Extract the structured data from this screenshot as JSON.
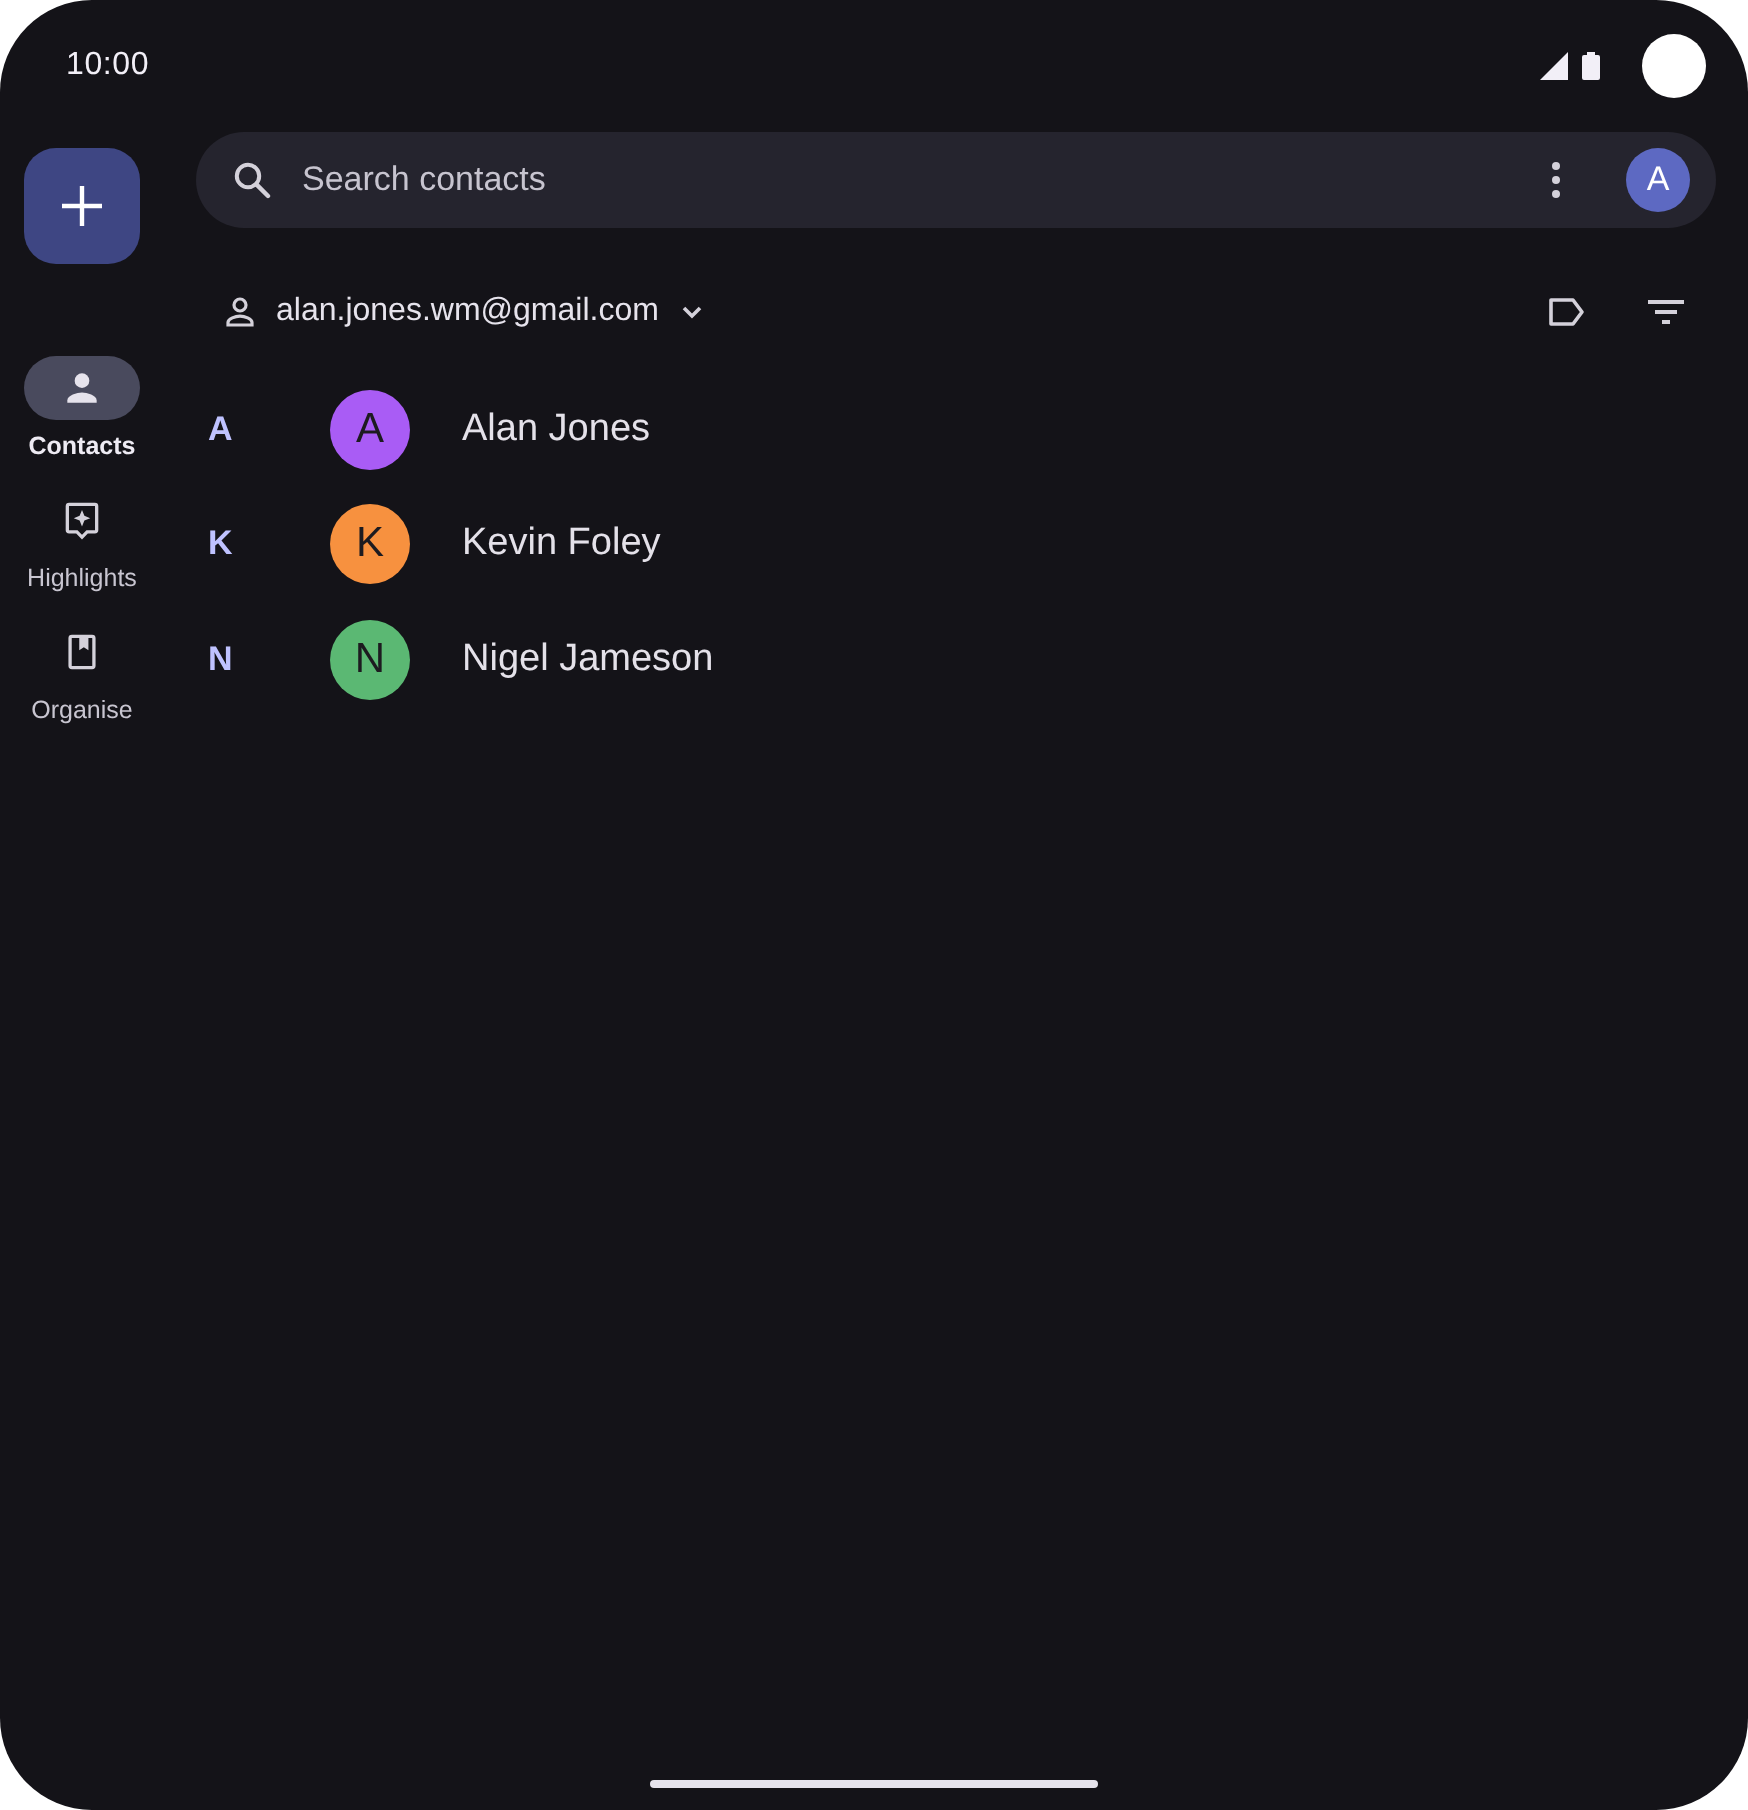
{
  "status_bar": {
    "time": "10:00"
  },
  "nav_rail": {
    "items": [
      {
        "label": "Contacts",
        "selected": true
      },
      {
        "label": "Highlights",
        "selected": false
      },
      {
        "label": "Organise",
        "selected": false
      }
    ]
  },
  "search": {
    "placeholder": "Search contacts",
    "account_initial": "A"
  },
  "account": {
    "email": "alan.jones.wm@gmail.com"
  },
  "contacts": [
    {
      "section": "A",
      "initial": "A",
      "name": "Alan Jones",
      "color": "#a95cf5"
    },
    {
      "section": "K",
      "initial": "K",
      "name": "Kevin Foley",
      "color": "#f7913f"
    },
    {
      "section": "N",
      "initial": "N",
      "name": "Nigel Jameson",
      "color": "#5bb873"
    }
  ]
}
